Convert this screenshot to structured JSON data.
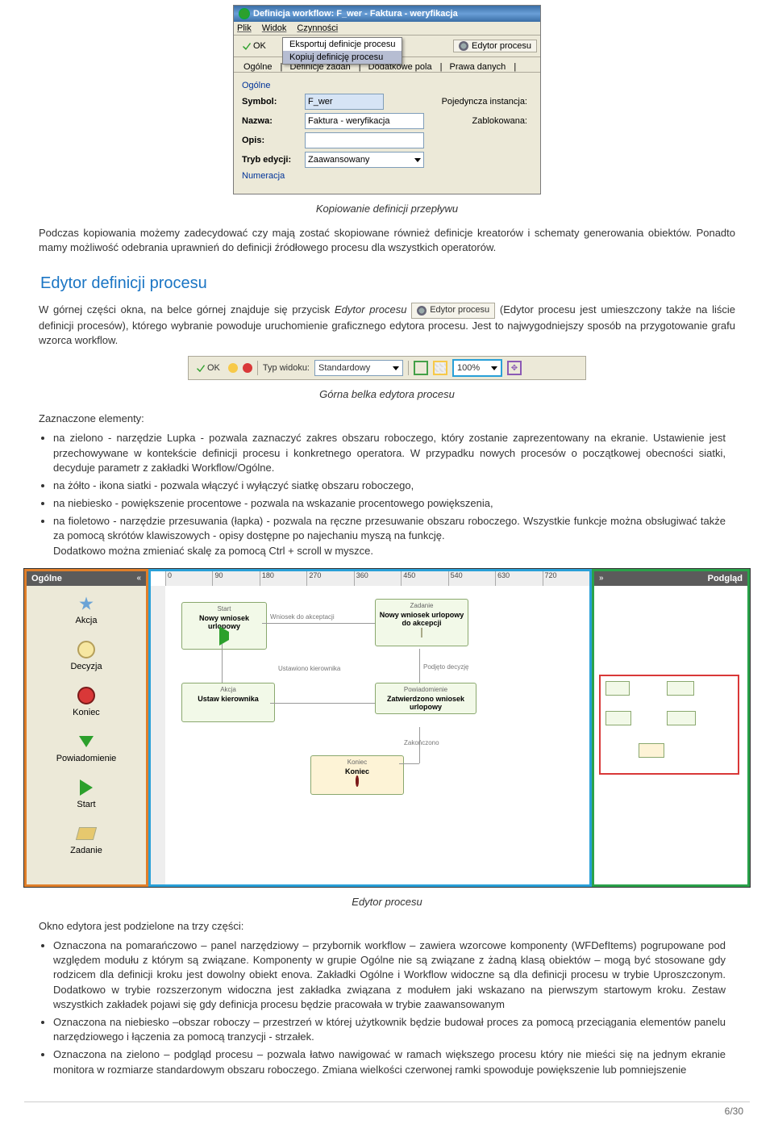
{
  "win": {
    "title": "Definicja workflow: F_wer - Faktura - weryfikacja",
    "menu": {
      "plik": "Plik",
      "widok": "Widok",
      "czynnosci": "Czynności"
    },
    "ok": "OK",
    "dropdown": {
      "eksport": "Eksportuj definicje procesu",
      "kopiuj": "Kopiuj definicję procesu"
    },
    "ed_btn": "Edytor procesu",
    "tabs": {
      "ogolne": "Ogólne",
      "defzadan": "Definicje zadań",
      "dodpola": "Dodatkowe pola",
      "prawa": "Prawa danych"
    },
    "group": "Ogólne",
    "symbol_lbl": "Symbol:",
    "symbol_val": "F_wer",
    "nazwa_lbl": "Nazwa:",
    "nazwa_val": "Faktura - weryfikacja",
    "opis_lbl": "Opis:",
    "tryb_lbl": "Tryb edycji:",
    "tryb_val": "Zaawansowany",
    "poj_lbl": "Pojedyncza instancja:",
    "zab_lbl": "Zablokowana:",
    "numer": "Numeracja"
  },
  "cap1": "Kopiowanie definicji przepływu",
  "p1": "Podczas kopiowania możemy zadecydować czy mają zostać skopiowane również definicje kreatorów i schematy generowania obiektów. Ponadto mamy możliwość odebrania uprawnień do definicji źródłowego procesu dla wszystkich operatorów.",
  "h1": "Edytor definicji procesu",
  "p2a": "W górnej części okna, na belce górnej znajduje się przycisk ",
  "p2i": "Edytor procesu",
  "inline_btn": "Edytor procesu",
  "p2b": " (Edytor procesu jest umieszczony także na liście definicji procesów), którego wybranie powoduje uruchomienie graficznego edytora procesu. Jest to najwygodniejszy sposób na przygotowanie grafu wzorca workflow.",
  "strip": {
    "ok": "OK",
    "typ_lbl": "Typ widoku:",
    "typ_val": "Standardowy",
    "zoom": "100%"
  },
  "cap2": "Górna belka edytora procesu",
  "p3": "Zaznaczone elementy:",
  "bul1": "na zielono - narzędzie Lupka - pozwala zaznaczyć zakres obszaru roboczego, który zostanie zaprezentowany na ekranie. Ustawienie jest przechowywane w kontekście definicji procesu i konkretnego operatora. W przypadku nowych procesów o początkowej obecności siatki, decyduje parametr z zakładki Workflow/Ogólne.",
  "bul2": "na żółto - ikona siatki - pozwala włączyć i wyłączyć siatkę obszaru roboczego,",
  "bul3": "na niebiesko - powiększenie procentowe - pozwala na wskazanie procentowego powiększenia,",
  "bul4": "na fioletowo - narzędzie przesuwania (łapka) - pozwala na ręczne przesuwanie obszaru roboczego. Wszystkie funkcje można obsługiwać także za pomocą skrótów klawiszowych - opisy dostępne po najechaniu myszą na funkcję.",
  "bul4b": "Dodatkowo można zmieniać skalę za pomocą Ctrl + scroll w myszce.",
  "left": {
    "title": "Ogólne",
    "items": [
      "Akcja",
      "Decyzja",
      "Koniec",
      "Powiadomienie",
      "Start",
      "Zadanie"
    ]
  },
  "ruler": [
    "0",
    "90",
    "180",
    "270",
    "360",
    "450",
    "540",
    "630",
    "720"
  ],
  "nodes": {
    "n1": {
      "ttl": "Start",
      "bod": "Nowy wniosek urlopowy"
    },
    "n2": {
      "ttl": "Zadanie",
      "bod": "Nowy wniosek urlopowy do akcepcji"
    },
    "n3": {
      "ttl": "Akcja",
      "bod": "Ustaw kierownika"
    },
    "n4": {
      "ttl": "Powiadomienie",
      "bod": "Zatwierdzono wniosek urlopowy"
    },
    "n5": {
      "ttl": "Koniec",
      "bod": "Koniec"
    }
  },
  "conns": {
    "c1": "Wniosek do akceptacji",
    "c2": "Ustawiono kierownika",
    "c3": "Podjęto decyzję",
    "c4": "Zakończono"
  },
  "right": {
    "title": "Podgląd"
  },
  "cap3": "Edytor procesu",
  "p4": "Okno edytora jest podzielone na trzy części:",
  "bl1": "Oznaczona na pomarańczowo – panel narzędziowy – przybornik workflow – zawiera wzorcowe komponenty (WFDefItems) pogrupowane pod względem modułu z którym są związane. Komponenty w grupie Ogólne nie są związane z żadną klasą obiektów – mogą być stosowane gdy rodzicem dla definicji kroku jest dowolny obiekt enova. Zakładki Ogólne i Workflow widoczne są dla definicji procesu w trybie Uproszczonym. Dodatkowo w trybie rozszerzonym widoczna jest zakładka związana z modułem jaki wskazano na pierwszym startowym kroku. Zestaw wszystkich zakładek pojawi się gdy definicja procesu będzie pracowała w trybie zaawansowanym",
  "bl2": "Oznaczona na niebiesko –obszar roboczy – przestrzeń w której użytkownik będzie budował proces za pomocą przeciągania elementów panelu narzędziowego i łączenia za pomocą tranzycji - strzałek.",
  "bl3": "Oznaczona na zielono – podgląd procesu – pozwala łatwo nawigować w ramach większego procesu który nie mieści się na jednym ekranie monitora w rozmiarze standardowym obszaru roboczego. Zmiana wielkości czerwonej ramki spowoduje powiększenie lub pomniejszenie",
  "page": "6/30"
}
